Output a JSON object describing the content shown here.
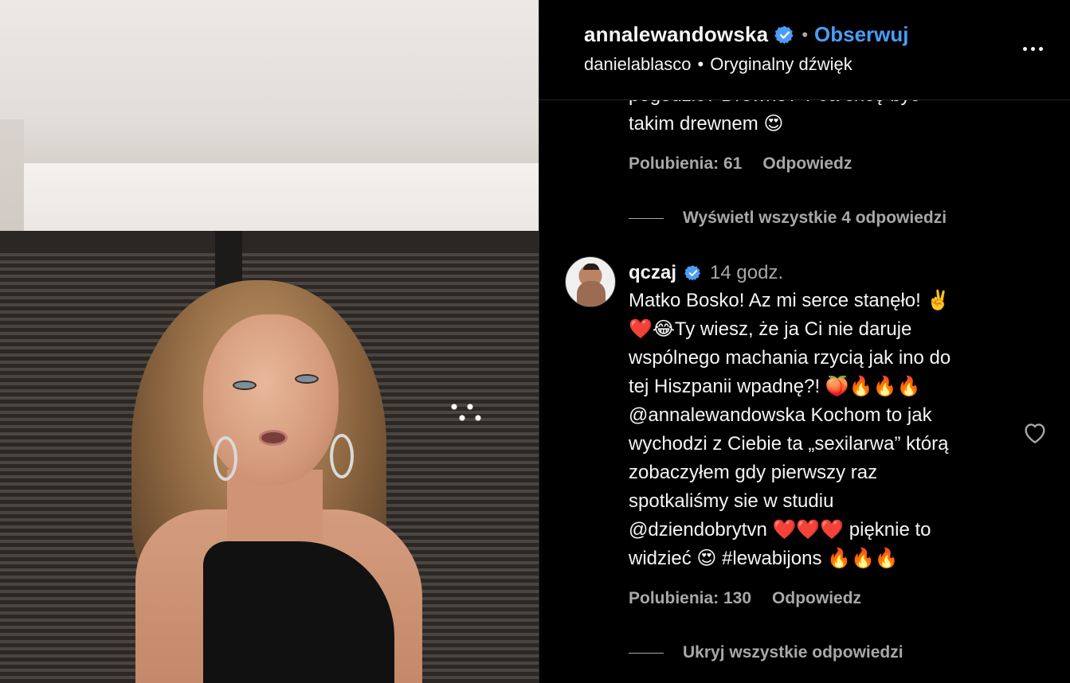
{
  "header": {
    "username": "annalewandowska",
    "separator": "•",
    "follow_label": "Obserwuj",
    "audio_author": "danielablasco",
    "audio_separator": "•",
    "audio_title": "Oryginalny dźwięk"
  },
  "previous_comment": {
    "text_partial": "pogodzić? Drewno? ? Ja chcę być",
    "text_line2": "takim drewnem 😍",
    "likes_label": "Polubienia: 61",
    "reply_label": "Odpowiedz",
    "view_replies_label": "Wyświetl wszystkie 4 odpowiedzi"
  },
  "comment": {
    "username": "qczaj",
    "time": "14 godz.",
    "lines": [
      "Matko Bosko! Az mi serce stanęło! ✌️",
      "❤️😂Ty wiesz, że ja Ci nie daruje",
      "wspólnego machania rzycią jak ino do",
      "tej Hiszpanii wpadnę?! 🍑🔥🔥🔥",
      "@annalewandowska Kochom to jak",
      "wychodzi z Ciebie ta „sexilarwa” którą",
      "zobaczyłem gdy pierwszy raz",
      "spotkaliśmy sie w studiu",
      "@dziendobrytvn ❤️❤️❤️ pięknie to",
      "widzieć 😍 #lewabijons 🔥🔥🔥"
    ],
    "likes_label": "Polubienia: 130",
    "reply_label": "Odpowiedz",
    "hide_replies_label": "Ukryj wszystkie odpowiedzi"
  },
  "icons": {
    "verified": "verified-badge-icon",
    "more": "more-options-icon",
    "like": "heart-outline-icon"
  },
  "colors": {
    "accent": "#4a9df8",
    "muted": "#a8a8a8",
    "text": "#f5f5f5",
    "background": "#000000"
  }
}
